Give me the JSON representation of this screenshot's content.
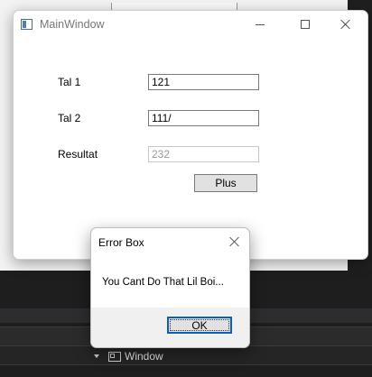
{
  "main_window": {
    "title": "MainWindow",
    "fields": [
      {
        "label": "Tal 1",
        "value": "121"
      },
      {
        "label": "Tal 2",
        "value": "111/"
      },
      {
        "label": "Resultat",
        "value": "232"
      }
    ],
    "plus_label": "Plus"
  },
  "error_box": {
    "title": "Error Box",
    "message": "You Cant Do That Lil Boi...",
    "ok_label": "OK"
  },
  "ide": {
    "window_tab_label": "Window"
  },
  "icons": [
    "app-icon",
    "minimize-icon",
    "maximize-icon",
    "close-icon",
    "window-icon",
    "caret-down-icon"
  ]
}
